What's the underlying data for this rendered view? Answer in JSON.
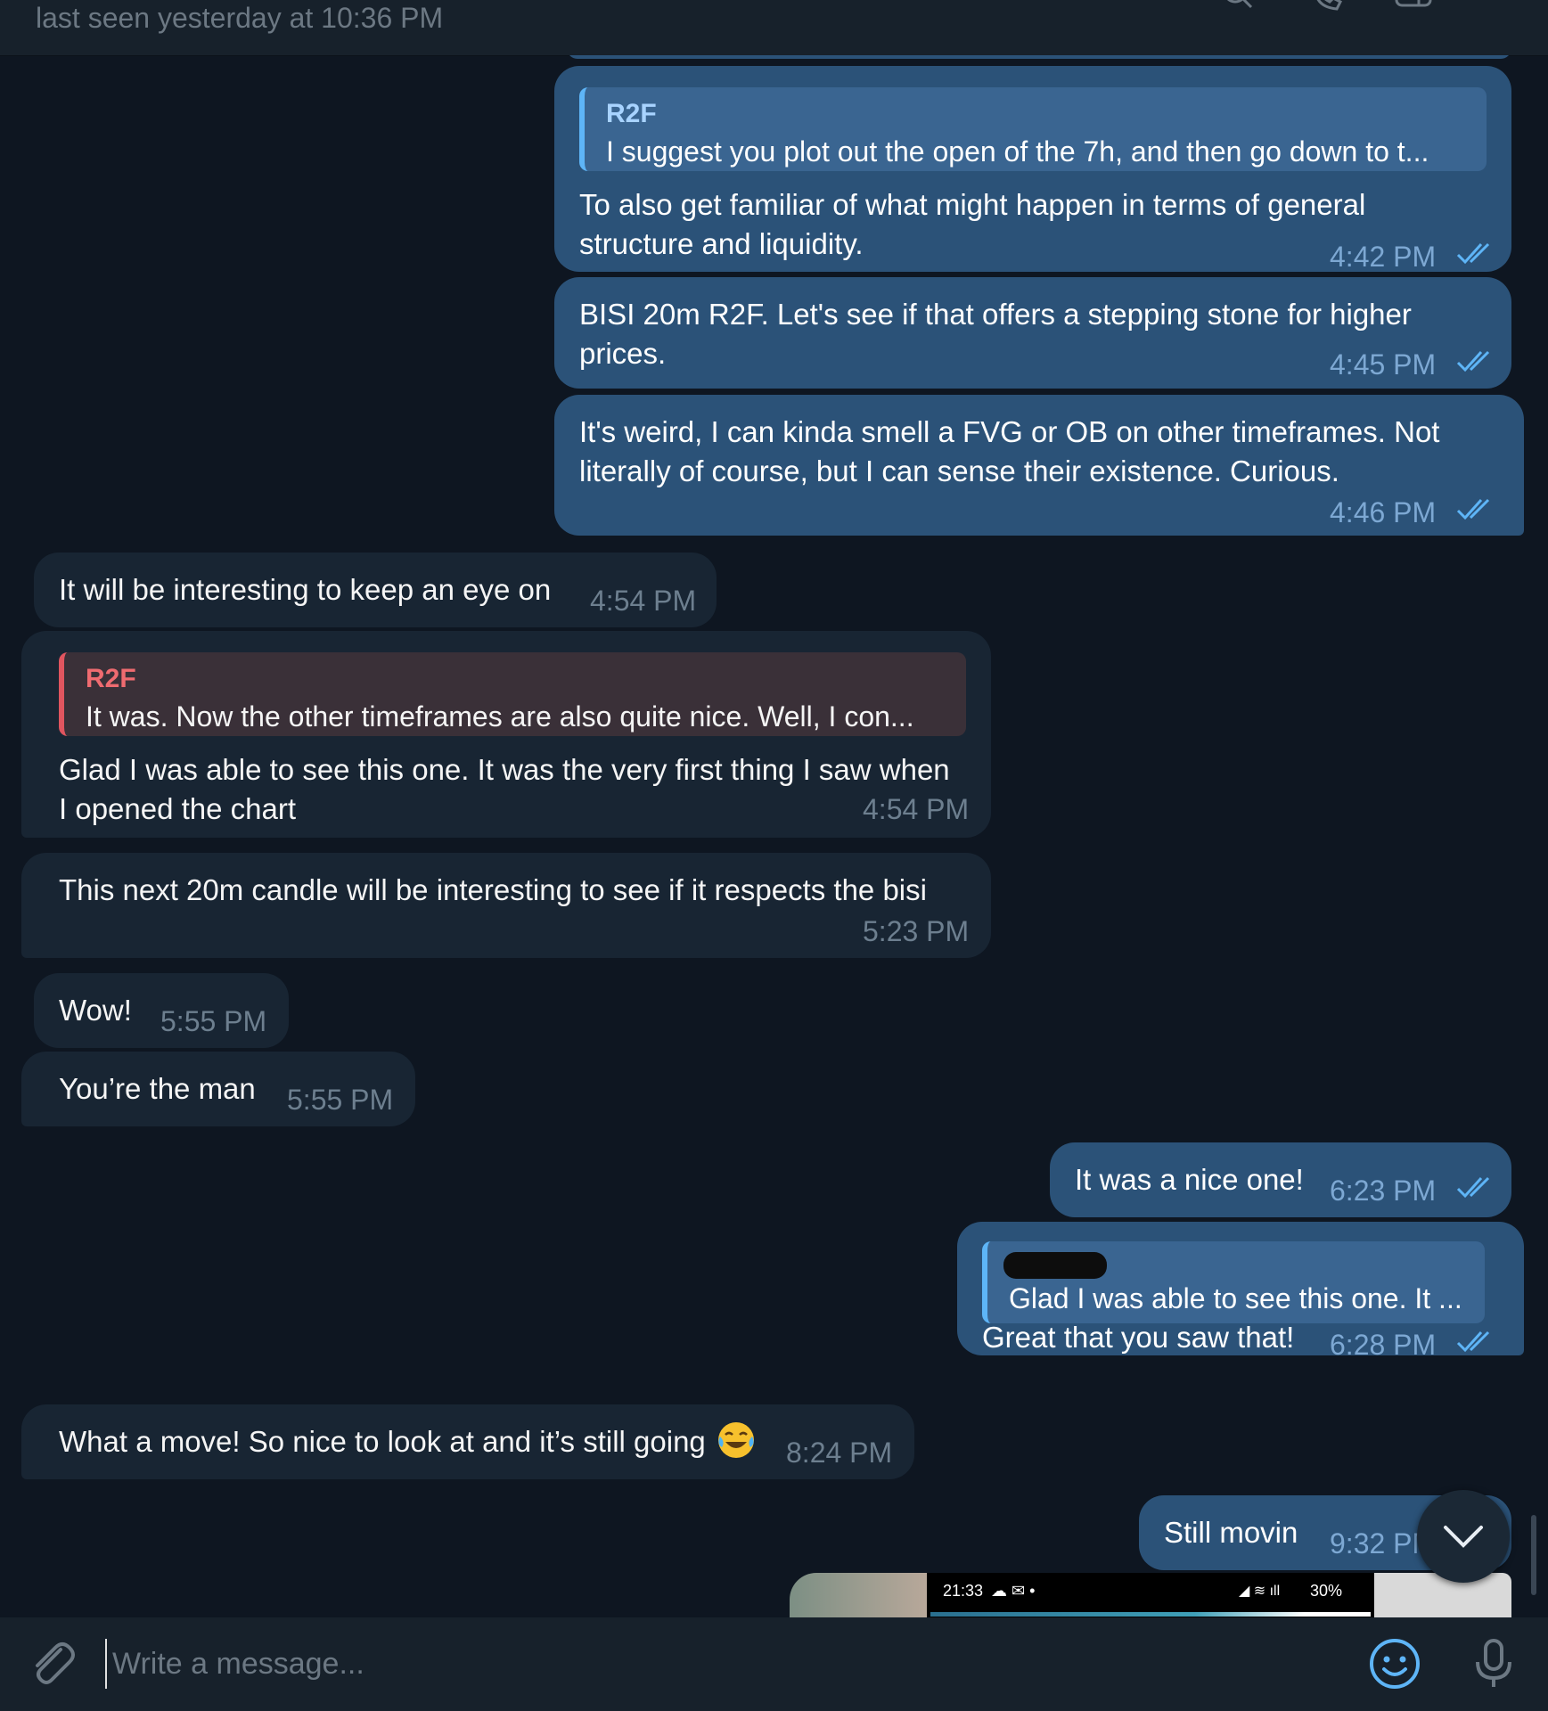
{
  "header": {
    "status": "last seen yesterday at 10:36 PM",
    "icons": [
      "search-icon",
      "phone-icon",
      "sidebar-icon",
      "more-icon"
    ]
  },
  "messages": [
    {
      "direction": "out",
      "reply_name": "R2F",
      "reply_text": "I suggest you plot out the open of the 7h, and then go down to t...",
      "text": "To also get familiar of what might happen in terms of general\nstructure and liquidity.",
      "time": "4:42 PM",
      "read": true
    },
    {
      "direction": "out",
      "text": "BISI 20m R2F. Let's see if that offers a stepping stone for higher\nprices.",
      "time": "4:45 PM",
      "read": true
    },
    {
      "direction": "out",
      "text": "It's weird, I can kinda smell a FVG or OB on other timeframes. Not\nliterally of course, but I can sense their existence. Curious.",
      "time": "4:46 PM",
      "read": true
    },
    {
      "direction": "in",
      "text": "It will be interesting to keep an eye on",
      "time": "4:54 PM"
    },
    {
      "direction": "in",
      "reply_name": "R2F",
      "reply_text": "It was. Now the other timeframes are also quite nice. Well, I con...",
      "text": "Glad I was able to see this one. It was the very first thing I saw when\nI opened the chart",
      "time": "4:54 PM"
    },
    {
      "direction": "in",
      "text": "This next 20m candle will be interesting to see if it respects the bisi",
      "time": "5:23 PM"
    },
    {
      "direction": "in",
      "text": "Wow!",
      "time": "5:55 PM"
    },
    {
      "direction": "in",
      "text": "You’re the man",
      "time": "5:55 PM"
    },
    {
      "direction": "out",
      "text": "It was a nice one!",
      "time": "6:23 PM",
      "read": true
    },
    {
      "direction": "out",
      "reply_name": "",
      "reply_text": "Glad I was able to see this one. It ...",
      "text": "Great that you saw that!",
      "time": "6:28 PM",
      "read": true
    },
    {
      "direction": "in",
      "text": "What a move! So nice to look at and it’s still going",
      "emoji": "face-with-tears-of-joy-emoji",
      "time": "8:24 PM"
    },
    {
      "direction": "out",
      "text": "Still movin",
      "time": "9:32 PM",
      "read": true
    }
  ],
  "photo_preview": {
    "status_time": "21:33",
    "battery": "30%"
  },
  "composer": {
    "placeholder": "Write a message...",
    "icons": [
      "attach-icon",
      "emoji-icon",
      "microphone-icon"
    ]
  },
  "colors": {
    "background": "#0e1621",
    "outgoing_bubble": "#2b5278",
    "incoming_bubble": "#182533",
    "header": "#17212b",
    "read_check": "#5eb5f7",
    "reply_in_accent": "#e0555f"
  }
}
